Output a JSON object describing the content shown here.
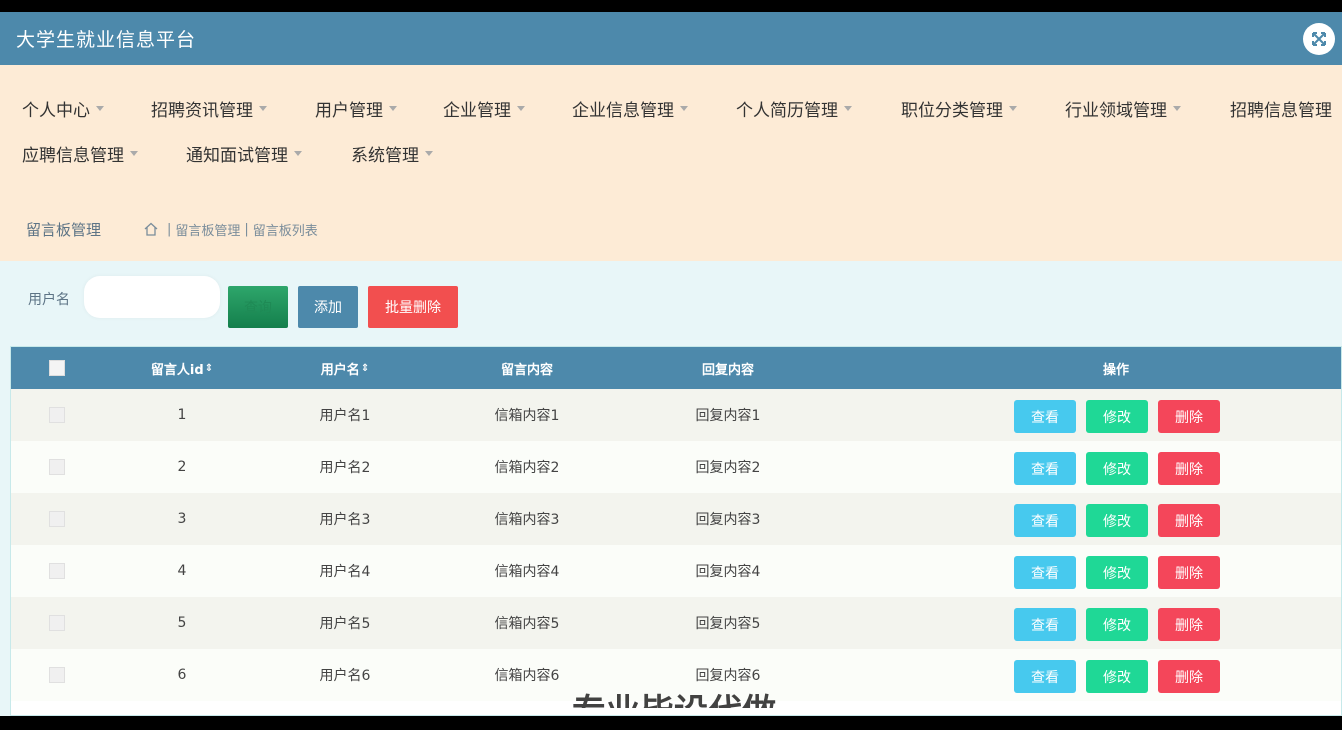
{
  "app": {
    "title": "大学生就业信息平台"
  },
  "menu": [
    {
      "label": "个人中心"
    },
    {
      "label": "招聘资讯管理"
    },
    {
      "label": "用户管理"
    },
    {
      "label": "企业管理"
    },
    {
      "label": "企业信息管理"
    },
    {
      "label": "个人简历管理"
    },
    {
      "label": "职位分类管理"
    },
    {
      "label": "行业领域管理"
    },
    {
      "label": "招聘信息管理"
    },
    {
      "label": "应聘信息管理"
    },
    {
      "label": "通知面试管理"
    },
    {
      "label": "系统管理"
    }
  ],
  "breadcrumb": {
    "title": "留言板管理",
    "path": [
      "留言板管理",
      "留言板列表"
    ]
  },
  "search": {
    "label": "用户名",
    "value": "",
    "placeholder": ""
  },
  "toolbar": {
    "query_label": "查询",
    "add_label": "添加",
    "batch_delete_label": "批量删除"
  },
  "table": {
    "columns": [
      "留言人id",
      "用户名",
      "留言内容",
      "回复内容",
      "操作"
    ],
    "rows": [
      {
        "id": "1",
        "username": "用户名1",
        "content": "信箱内容1",
        "reply": "回复内容1"
      },
      {
        "id": "2",
        "username": "用户名2",
        "content": "信箱内容2",
        "reply": "回复内容2"
      },
      {
        "id": "3",
        "username": "用户名3",
        "content": "信箱内容3",
        "reply": "回复内容3"
      },
      {
        "id": "4",
        "username": "用户名4",
        "content": "信箱内容4",
        "reply": "回复内容4"
      },
      {
        "id": "5",
        "username": "用户名5",
        "content": "信箱内容5",
        "reply": "回复内容5"
      },
      {
        "id": "6",
        "username": "用户名6",
        "content": "信箱内容6",
        "reply": "回复内容6"
      }
    ],
    "actions": {
      "view": "查看",
      "edit": "修改",
      "delete": "删除"
    }
  },
  "watermark": "专业毕设代做",
  "colors": {
    "header": "#4d89ab",
    "menu_bg": "#fdebd6",
    "content_bg": "#e8f6f8",
    "view": "#47c9ee",
    "edit": "#1fd896",
    "delete": "#f4465a"
  }
}
